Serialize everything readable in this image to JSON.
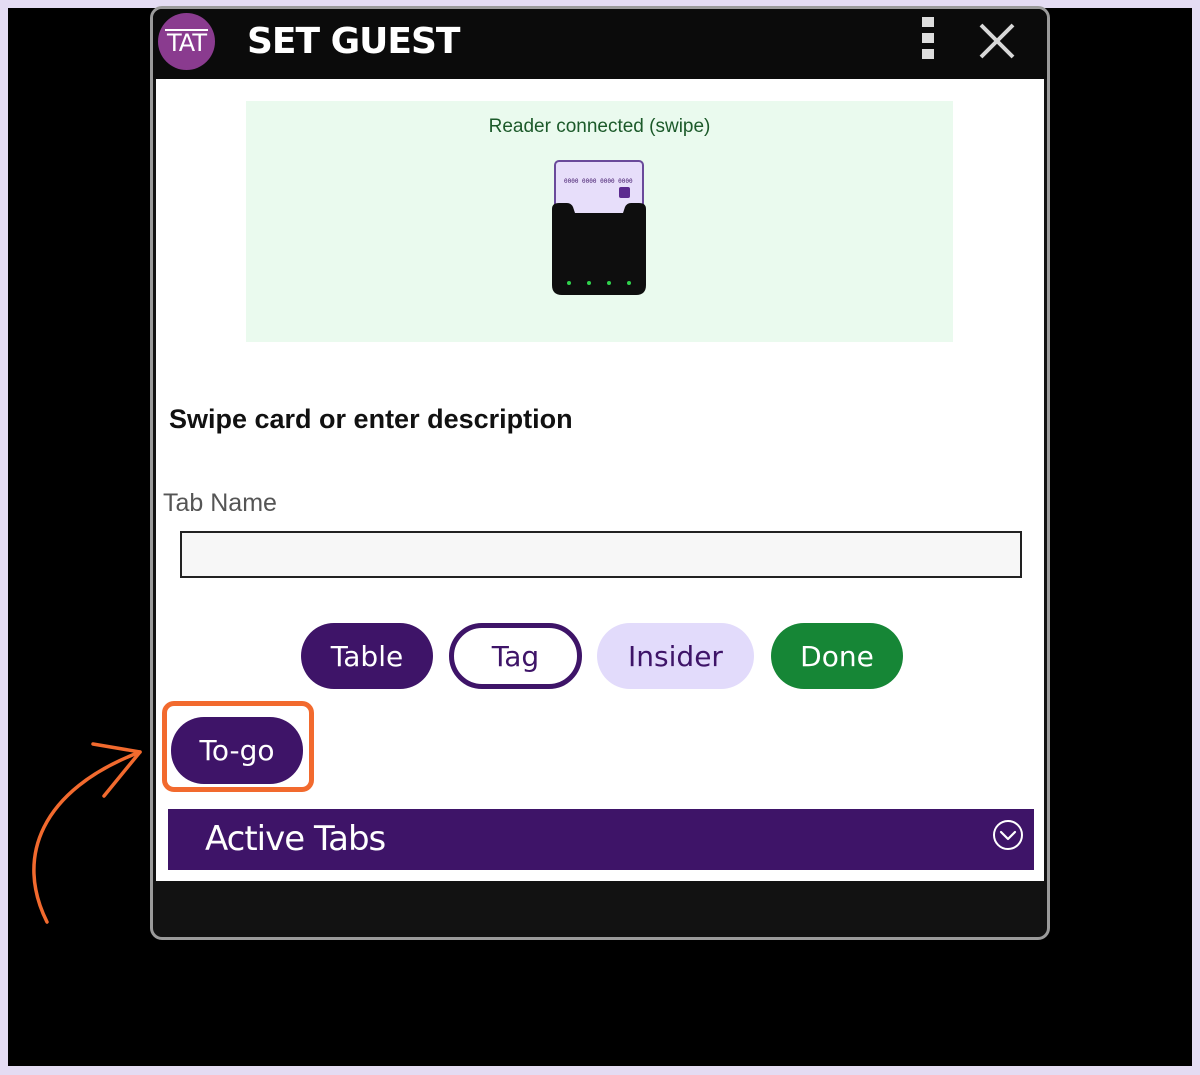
{
  "dialog": {
    "title": "SET GUEST",
    "logo_text": "TAT",
    "menu_icon": "kebab-menu-icon",
    "close_icon": "close-icon"
  },
  "reader": {
    "status": "Reader connected (swipe)",
    "card_number_mask": "0000 0000 0000 0000",
    "icon": "card-reader-icon"
  },
  "form": {
    "prompt": "Swipe card or enter description",
    "tab_name_label": "Tab Name",
    "tab_name_value": "",
    "tab_name_placeholder": ""
  },
  "buttons": {
    "table": "Table",
    "tag": "Tag",
    "insider": "Insider",
    "done": "Done",
    "togo": "To-go"
  },
  "active_tabs": {
    "label": "Active Tabs",
    "icon": "chevron-down-circle-icon"
  },
  "colors": {
    "purple": "#3e1468",
    "green": "#168636",
    "light_purple": "#e2dbfb",
    "highlight_orange": "#f26a2e",
    "reader_bg": "#eafaee"
  }
}
